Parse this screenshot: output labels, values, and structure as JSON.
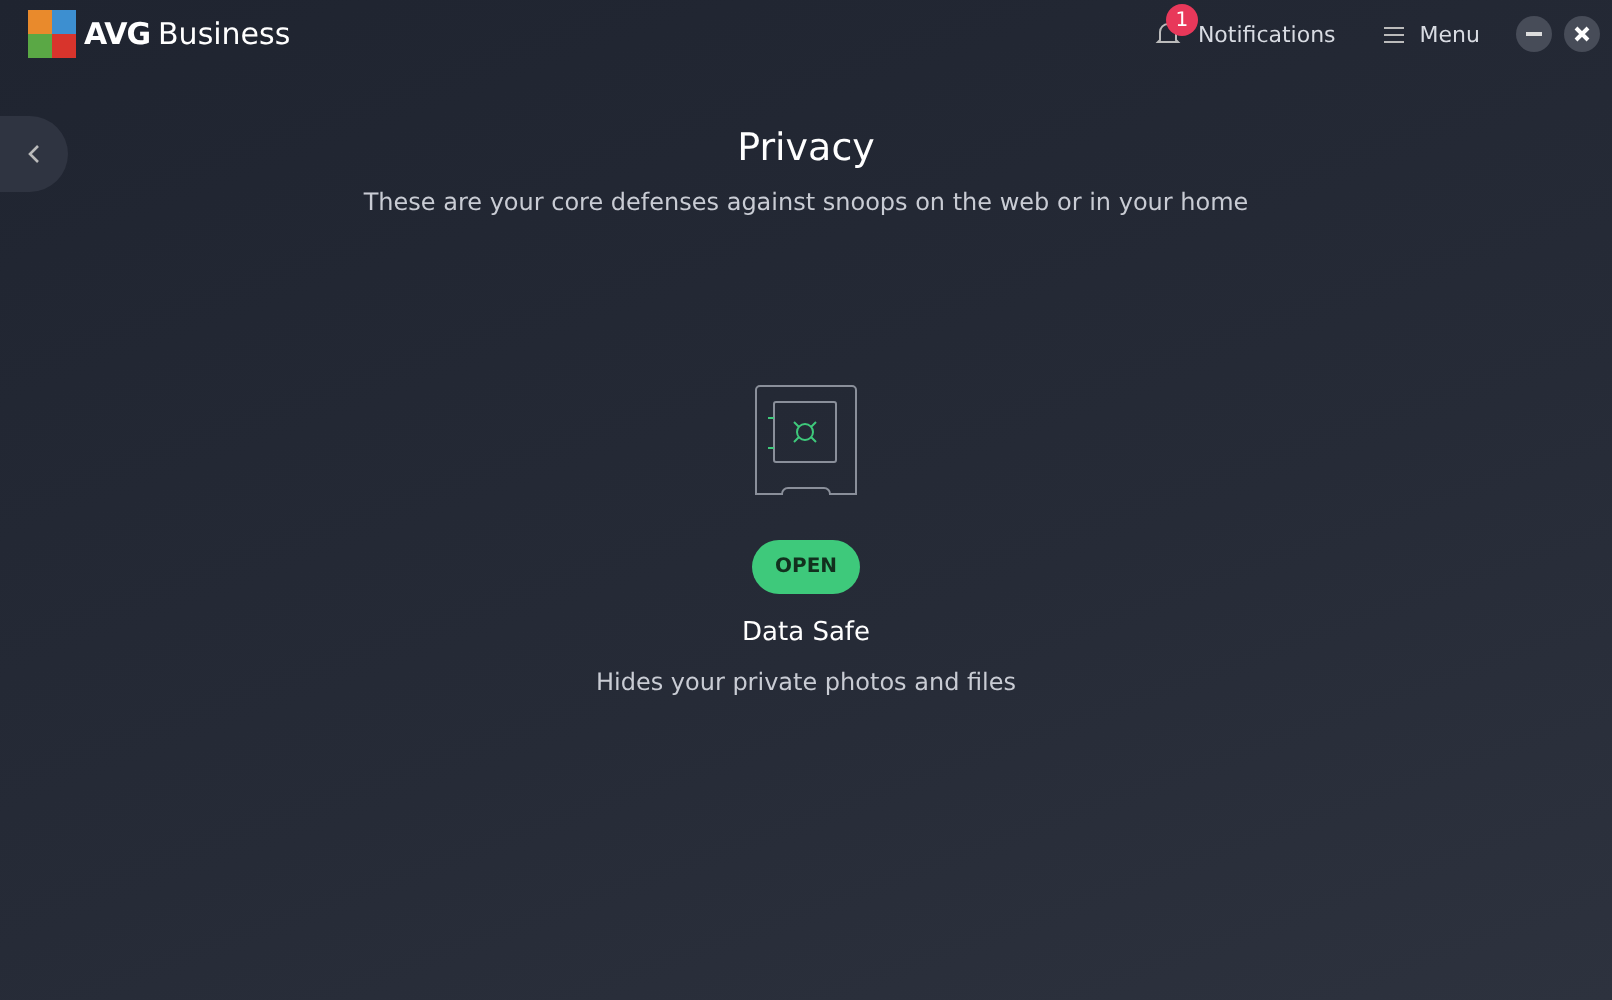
{
  "app": {
    "brand_bold": "AVG",
    "brand": "Business"
  },
  "header": {
    "notifications": {
      "count": "1",
      "label": "Notifications"
    },
    "menu": "Menu"
  },
  "page": {
    "title": "Privacy",
    "subtitle": "These are your core defenses against snoops on the web or in your home"
  },
  "feature": {
    "button": "OPEN",
    "name": "Data Safe",
    "description": "Hides your private photos and files"
  }
}
